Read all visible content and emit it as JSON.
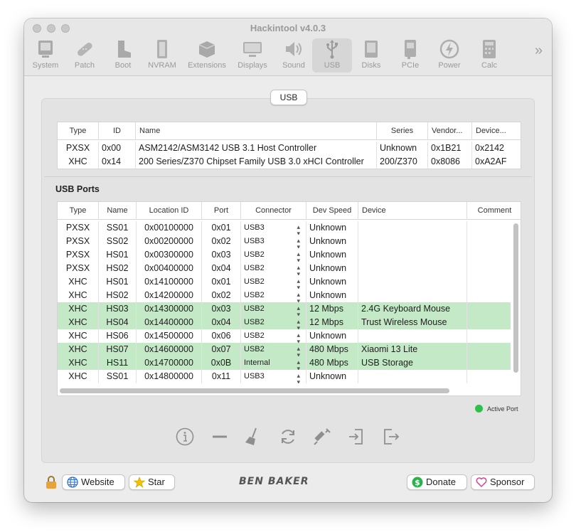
{
  "window": {
    "title": "Hackintool v4.0.3"
  },
  "toolbar": {
    "items": [
      {
        "label": "System",
        "icon": "computer-icon"
      },
      {
        "label": "Patch",
        "icon": "bandage-icon"
      },
      {
        "label": "Boot",
        "icon": "boot-icon"
      },
      {
        "label": "NVRAM",
        "icon": "nvram-chip-icon"
      },
      {
        "label": "Extensions",
        "icon": "extension-box-icon"
      },
      {
        "label": "Displays",
        "icon": "display-icon"
      },
      {
        "label": "Sound",
        "icon": "speaker-icon"
      },
      {
        "label": "USB",
        "icon": "usb-icon",
        "active": true
      },
      {
        "label": "Disks",
        "icon": "disk-icon"
      },
      {
        "label": "PCIe",
        "icon": "pcie-card-icon"
      },
      {
        "label": "Power",
        "icon": "power-bolt-icon"
      },
      {
        "label": "Calc",
        "icon": "calculator-icon"
      }
    ],
    "overflow_glyph": "»"
  },
  "tab": {
    "label": "USB"
  },
  "controllers": {
    "columns": [
      "Type",
      "ID",
      "Name",
      "Series",
      "Vendor...",
      "Device..."
    ],
    "rows": [
      [
        "PXSX",
        "0x00",
        "ASM2142/ASM3142 USB 3.1 Host Controller",
        "Unknown",
        "0x1B21",
        "0x2142"
      ],
      [
        "XHC",
        "0x14",
        "200 Series/Z370 Chipset Family USB 3.0 xHCI Controller",
        "200/Z370",
        "0x8086",
        "0xA2AF"
      ]
    ]
  },
  "usb_ports": {
    "title": "USB Ports",
    "columns": [
      "Type",
      "Name",
      "Location ID",
      "Port",
      "Connector",
      "Dev Speed",
      "Device",
      "Comment"
    ],
    "rows": [
      {
        "cells": [
          "PXSX",
          "SS01",
          "0x00100000",
          "0x01",
          "USB3",
          "Unknown",
          "",
          ""
        ],
        "active": false
      },
      {
        "cells": [
          "PXSX",
          "SS02",
          "0x00200000",
          "0x02",
          "USB3",
          "Unknown",
          "",
          ""
        ],
        "active": false
      },
      {
        "cells": [
          "PXSX",
          "HS01",
          "0x00300000",
          "0x03",
          "USB2",
          "Unknown",
          "",
          ""
        ],
        "active": false
      },
      {
        "cells": [
          "PXSX",
          "HS02",
          "0x00400000",
          "0x04",
          "USB2",
          "Unknown",
          "",
          ""
        ],
        "active": false
      },
      {
        "cells": [
          "XHC",
          "HS01",
          "0x14100000",
          "0x01",
          "USB2",
          "Unknown",
          "",
          ""
        ],
        "active": false
      },
      {
        "cells": [
          "XHC",
          "HS02",
          "0x14200000",
          "0x02",
          "USB2",
          "Unknown",
          "",
          ""
        ],
        "active": false
      },
      {
        "cells": [
          "XHC",
          "HS03",
          "0x14300000",
          "0x03",
          "USB2",
          "12 Mbps",
          "2.4G Keyboard Mouse",
          ""
        ],
        "active": true
      },
      {
        "cells": [
          "XHC",
          "HS04",
          "0x14400000",
          "0x04",
          "USB2",
          "12 Mbps",
          "Trust Wireless Mouse",
          ""
        ],
        "active": true
      },
      {
        "cells": [
          "XHC",
          "HS06",
          "0x14500000",
          "0x06",
          "USB2",
          "Unknown",
          "",
          ""
        ],
        "active": false
      },
      {
        "cells": [
          "XHC",
          "HS07",
          "0x14600000",
          "0x07",
          "USB2",
          "480 Mbps",
          "Xiaomi 13 Lite",
          ""
        ],
        "active": true
      },
      {
        "cells": [
          "XHC",
          "HS11",
          "0x14700000",
          "0x0B",
          "Internal",
          "480 Mbps",
          "USB Storage",
          ""
        ],
        "active": true
      },
      {
        "cells": [
          "XHC",
          "SS01",
          "0x14800000",
          "0x11",
          "USB3",
          "Unknown",
          "",
          ""
        ],
        "active": false
      }
    ]
  },
  "legend": {
    "active_port_label": "Active Port",
    "active_color": "#2ec04b",
    "row_highlight_color": "#c4e9c7"
  },
  "actions": [
    {
      "icon": "info-icon"
    },
    {
      "icon": "minus-icon"
    },
    {
      "icon": "broom-icon"
    },
    {
      "icon": "refresh-icon"
    },
    {
      "icon": "syringe-icon"
    },
    {
      "icon": "import-icon"
    },
    {
      "icon": "export-icon"
    }
  ],
  "footer": {
    "website_label": "Website",
    "star_label": "Star",
    "brand": "BEN BAKER",
    "donate_label": "Donate",
    "sponsor_label": "Sponsor"
  }
}
